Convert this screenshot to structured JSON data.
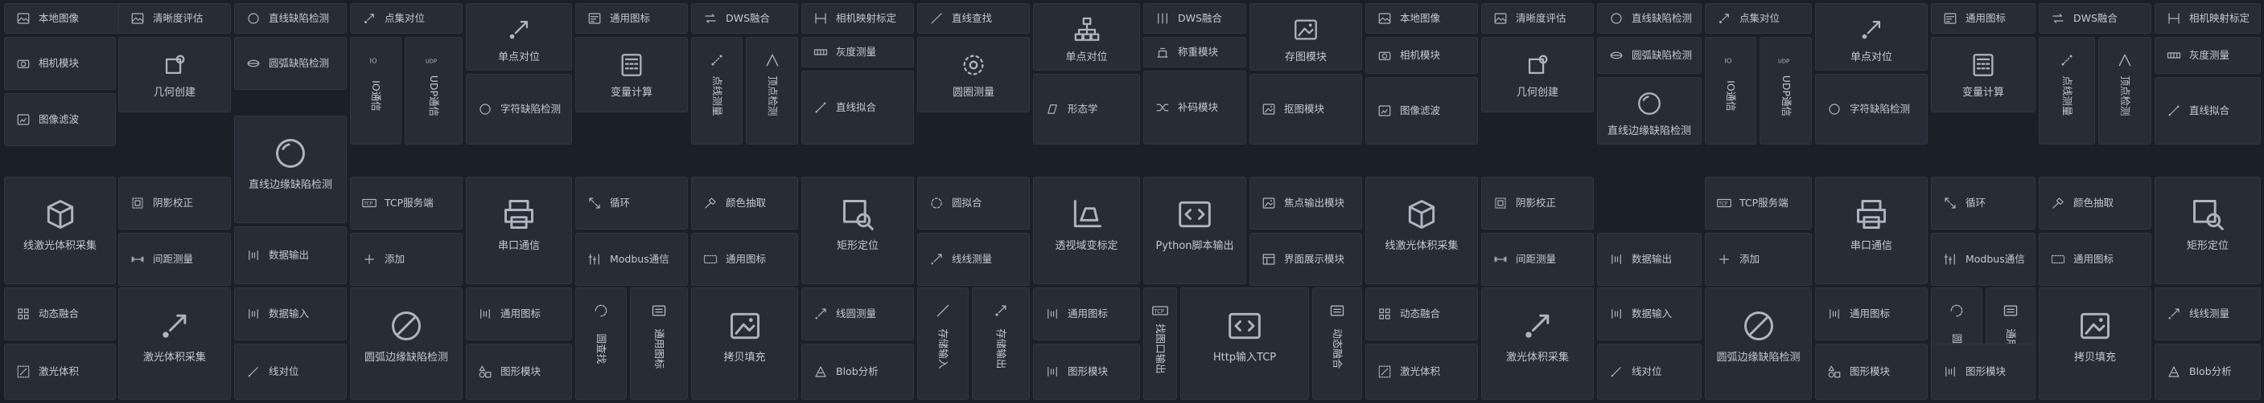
{
  "theme": {
    "background": "#1b2028",
    "tile": "#272d37",
    "text": "#c3c8d1",
    "icon": "#aeb5c1"
  },
  "tiles": [
    {
      "name": "local-image",
      "label": "本地图像",
      "icon": "image-icon",
      "style": "row"
    },
    {
      "name": "sharpness-eval",
      "label": "清晰度评估",
      "icon": "image-icon",
      "style": "row"
    },
    {
      "name": "line-defect-detect",
      "label": "直线缺陷检测",
      "icon": "circle-icon",
      "style": "row"
    },
    {
      "name": "point-align",
      "label": "点集对位",
      "icon": "point-arrow-icon",
      "style": "row"
    },
    {
      "name": "single-point-align",
      "label": "单点对位",
      "icon": "point-arrow-icon",
      "style": "col"
    },
    {
      "name": "general-chart",
      "label": "通用图标",
      "icon": "chart-icon",
      "style": "row"
    },
    {
      "name": "dws-fusion",
      "label": "DWS融合",
      "icon": "swap-icon",
      "style": "row"
    },
    {
      "name": "camera-map-calib",
      "label": "相机映射标定",
      "icon": "mapping-icon",
      "style": "row"
    },
    {
      "name": "line-find",
      "label": "直线查找",
      "icon": "line-icon",
      "style": "row"
    },
    {
      "name": "single-point-align-2",
      "label": "单点对位",
      "icon": "hierarchy-icon",
      "style": "col"
    },
    {
      "name": "dws-fusion-2",
      "label": "DWS融合",
      "icon": "dws-icon",
      "style": "row"
    },
    {
      "name": "store-image",
      "label": "存图模块",
      "icon": "picture-icon",
      "style": "col"
    },
    {
      "name": "local-image-2",
      "label": "本地图像",
      "icon": "image-icon",
      "style": "row"
    },
    {
      "name": "sharpness-eval-2",
      "label": "清晰度评估",
      "icon": "image-icon",
      "style": "row"
    },
    {
      "name": "line-defect-detect-2",
      "label": "直线缺陷检测",
      "icon": "circle-icon",
      "style": "row"
    },
    {
      "name": "point-align-2",
      "label": "点集对位",
      "icon": "point-arrow-icon",
      "style": "row"
    },
    {
      "name": "single-point-align-3",
      "label": "单点对位",
      "icon": "point-arrow-icon",
      "style": "col"
    },
    {
      "name": "general-chart-2",
      "label": "通用图标",
      "icon": "chart-icon",
      "style": "row"
    },
    {
      "name": "dws-fusion-3",
      "label": "DWS融合",
      "icon": "swap-icon",
      "style": "row"
    },
    {
      "name": "camera-map-calib-2",
      "label": "相机映射标定",
      "icon": "mapping-icon",
      "style": "row"
    },
    {
      "name": "camera-module",
      "label": "相机模块",
      "icon": "camera-icon",
      "style": "row"
    },
    {
      "name": "geometry-create",
      "label": "几何创建",
      "icon": "geometry-icon",
      "style": "col"
    },
    {
      "name": "circle-defect-detect",
      "label": "圆弧缺陷检测",
      "icon": "ellipse-icon",
      "style": "row"
    },
    {
      "name": "io-comm",
      "label": "IO通信",
      "icon": "io-icon",
      "style": "vert"
    },
    {
      "name": "udp-comm",
      "label": "UDP通信",
      "icon": "udp-icon",
      "style": "vert"
    },
    {
      "name": "variable-calc",
      "label": "变量计算",
      "icon": "calc-icon",
      "style": "col"
    },
    {
      "name": "dot-measure",
      "label": "点线测量",
      "icon": "dots-icon",
      "style": "vert"
    },
    {
      "name": "vertex-check",
      "label": "顶点检测",
      "icon": "vertex-icon",
      "style": "vert"
    },
    {
      "name": "gray-measure",
      "label": "灰度测量",
      "icon": "gray-icon",
      "style": "row"
    },
    {
      "name": "circle-measure",
      "label": "圆圈测量",
      "icon": "circles-icon",
      "style": "col"
    },
    {
      "name": "weigh-module",
      "label": "称重模块",
      "icon": "scale-icon",
      "style": "row"
    },
    {
      "name": "camera-module-2",
      "label": "相机模块",
      "icon": "camera-icon",
      "style": "row"
    },
    {
      "name": "geometry-create-2",
      "label": "几何创建",
      "icon": "geometry-icon",
      "style": "col"
    },
    {
      "name": "circle-defect-detect-2",
      "label": "圆弧缺陷检测",
      "icon": "ellipse-icon",
      "style": "row"
    },
    {
      "name": "io-comm-2",
      "label": "IO通信",
      "icon": "io-icon",
      "style": "vert"
    },
    {
      "name": "udp-comm-2",
      "label": "UDP通信",
      "icon": "udp-icon",
      "style": "vert"
    },
    {
      "name": "variable-calc-2",
      "label": "变量计算",
      "icon": "calc-icon",
      "style": "col"
    },
    {
      "name": "dot-measure-2",
      "label": "点线测量",
      "icon": "dots-icon",
      "style": "vert"
    },
    {
      "name": "vertex-check-2",
      "label": "顶点检测",
      "icon": "vertex-icon",
      "style": "vert"
    },
    {
      "name": "gray-measure-2",
      "label": "灰度测量",
      "icon": "gray-icon",
      "style": "row"
    },
    {
      "name": "image-filter",
      "label": "图像滤波",
      "icon": "filter-icon",
      "style": "row"
    },
    {
      "name": "line-edge-defect",
      "label": "直线边缘缺陷检测",
      "icon": "ring-icon",
      "style": "col"
    },
    {
      "name": "char-defect-detect",
      "label": "字符缺陷检测",
      "icon": "circle-icon",
      "style": "row"
    },
    {
      "name": "line-fit",
      "label": "直线拟合",
      "icon": "linefit-icon",
      "style": "row"
    },
    {
      "name": "morphology",
      "label": "形态学",
      "icon": "morph-icon",
      "style": "row"
    },
    {
      "name": "complement-module",
      "label": "补码模块",
      "icon": "shuffle-icon",
      "style": "row"
    },
    {
      "name": "save-image",
      "label": "抠图模块",
      "icon": "picture-icon",
      "style": "row"
    },
    {
      "name": "image-filter-2",
      "label": "图像滤波",
      "icon": "filter-icon",
      "style": "row"
    },
    {
      "name": "line-edge-defect-2",
      "label": "直线边缘缺陷检测",
      "icon": "ring-icon",
      "style": "col"
    },
    {
      "name": "char-defect-detect-2",
      "label": "字符缺陷检测",
      "icon": "circle-icon",
      "style": "row"
    },
    {
      "name": "line-fit-2",
      "label": "直线拟合",
      "icon": "linefit-icon",
      "style": "row"
    },
    {
      "name": "laser-volume-collect",
      "label": "线激光体积采集",
      "icon": "cube-icon",
      "style": "col"
    },
    {
      "name": "shadow-correct",
      "label": "阴影校正",
      "icon": "shadow-icon",
      "style": "row"
    },
    {
      "name": "tcp-server",
      "label": "TCP服务端",
      "icon": "tcp-icon",
      "style": "row"
    },
    {
      "name": "serial-comm",
      "label": "串口通信",
      "icon": "printer-icon",
      "style": "col"
    },
    {
      "name": "loop",
      "label": "循环",
      "icon": "expand-icon",
      "style": "row"
    },
    {
      "name": "color-extract",
      "label": "颜色抽取",
      "icon": "pipette-icon",
      "style": "row"
    },
    {
      "name": "rect-locate",
      "label": "矩形定位",
      "icon": "rect-search-icon",
      "style": "col"
    },
    {
      "name": "circle-fit",
      "label": "圆拟合",
      "icon": "circle-dash-icon",
      "style": "row"
    },
    {
      "name": "perspective-calib",
      "label": "透视域变标定",
      "icon": "perspective-icon",
      "style": "col"
    },
    {
      "name": "python-script",
      "label": "Python脚本输出",
      "icon": "code-icon",
      "style": "col"
    },
    {
      "name": "focus-output",
      "label": "焦点输出模块",
      "icon": "picture-icon",
      "style": "row"
    },
    {
      "name": "laser-volume-collect-2",
      "label": "线激光体积采集",
      "icon": "cube-icon",
      "style": "col"
    },
    {
      "name": "shadow-correct-2",
      "label": "阴影校正",
      "icon": "shadow-icon",
      "style": "row"
    },
    {
      "name": "tcp-server-2",
      "label": "TCP服务端",
      "icon": "tcp-icon",
      "style": "row"
    },
    {
      "name": "serial-comm-2",
      "label": "串口通信",
      "icon": "printer-icon",
      "style": "col"
    },
    {
      "name": "loop-2",
      "label": "循环",
      "icon": "expand-icon",
      "style": "row"
    },
    {
      "name": "color-extract-2",
      "label": "颜色抽取",
      "icon": "pipette-icon",
      "style": "row"
    },
    {
      "name": "rect-locate-2",
      "label": "矩形定位",
      "icon": "rect-search-icon",
      "style": "col"
    },
    {
      "name": "spacing-measure",
      "label": "间距测量",
      "icon": "spacing-icon",
      "style": "row"
    },
    {
      "name": "data-output",
      "label": "数据输出",
      "icon": "bracket-icon",
      "style": "row"
    },
    {
      "name": "add",
      "label": "添加",
      "icon": "plus-icon",
      "style": "row"
    },
    {
      "name": "modbus-comm",
      "label": "Modbus通信",
      "icon": "modbus-icon",
      "style": "row"
    },
    {
      "name": "general-chart-3",
      "label": "通用图标",
      "icon": "dots-box-icon",
      "style": "row"
    },
    {
      "name": "line-measure",
      "label": "线线测量",
      "icon": "arrow-line-icon",
      "style": "row"
    },
    {
      "name": "ui-display",
      "label": "界面展示模块",
      "icon": "layout-icon",
      "style": "row"
    },
    {
      "name": "spacing-measure-2",
      "label": "间距测量",
      "icon": "spacing-icon",
      "style": "row"
    },
    {
      "name": "data-output-2",
      "label": "数据输出",
      "icon": "bracket-icon",
      "style": "row"
    },
    {
      "name": "add-2",
      "label": "添加",
      "icon": "plus-icon",
      "style": "row"
    },
    {
      "name": "modbus-comm-2",
      "label": "Modbus通信",
      "icon": "modbus-icon",
      "style": "row"
    },
    {
      "name": "general-chart-4",
      "label": "通用图标",
      "icon": "dots-box-icon",
      "style": "row"
    },
    {
      "name": "dynamic-fusion",
      "label": "动态融合",
      "icon": "grid-icon",
      "style": "row"
    },
    {
      "name": "laser-volume-collect-3",
      "label": "激光体积采集",
      "icon": "point-arrow-icon",
      "style": "col"
    },
    {
      "name": "data-input",
      "label": "数据输入",
      "icon": "bracket-icon",
      "style": "row"
    },
    {
      "name": "arc-edge-defect",
      "label": "圆弧边缘缺陷检测",
      "icon": "no-entry-icon",
      "style": "col"
    },
    {
      "name": "general-chart-5",
      "label": "通用图标",
      "icon": "bracket-icon",
      "style": "row"
    },
    {
      "name": "circle-find",
      "label": "圆查找",
      "icon": "arc-icon",
      "style": "vert"
    },
    {
      "name": "general-chart-6",
      "label": "通用图标",
      "icon": "list-icon",
      "style": "vert"
    },
    {
      "name": "copy-fill",
      "label": "拷贝填充",
      "icon": "picture-icon",
      "style": "col"
    },
    {
      "name": "line-measure-2",
      "label": "线圆测量",
      "icon": "arrow-line-icon",
      "style": "row"
    },
    {
      "name": "store-input",
      "label": "存储输入",
      "icon": "line-icon",
      "style": "vert"
    },
    {
      "name": "store-output",
      "label": "存储输出",
      "icon": "point-arrow-icon",
      "style": "vert"
    },
    {
      "name": "general-chart-7",
      "label": "通用图标",
      "icon": "bracket-icon",
      "style": "row"
    },
    {
      "name": "tcp-input",
      "label": "找图口输出",
      "icon": "tcp-icon",
      "style": "vert"
    },
    {
      "name": "http-tcp-input",
      "label": "Http输入TCP",
      "icon": "code-icon",
      "style": "col"
    },
    {
      "name": "dynamic-fusion-v",
      "label": "动态融合",
      "icon": "list-icon",
      "style": "vert"
    },
    {
      "name": "dynamic-fusion-2",
      "label": "动态融合",
      "icon": "grid-icon",
      "style": "row"
    },
    {
      "name": "laser-volume-collect-4",
      "label": "激光体积采集",
      "icon": "point-arrow-icon",
      "style": "col"
    },
    {
      "name": "data-input-2",
      "label": "数据输入",
      "icon": "bracket-icon",
      "style": "row"
    },
    {
      "name": "arc-edge-defect-2",
      "label": "圆弧边缘缺陷检测",
      "icon": "no-entry-icon",
      "style": "col"
    },
    {
      "name": "general-chart-8",
      "label": "通用图标",
      "icon": "bracket-icon",
      "style": "row"
    },
    {
      "name": "circle-find-2",
      "label": "圆查找",
      "icon": "arc-icon",
      "style": "vert"
    },
    {
      "name": "general-chart-9",
      "label": "通用图标",
      "icon": "list-icon",
      "style": "vert"
    },
    {
      "name": "copy-fill-2",
      "label": "拷贝填充",
      "icon": "picture-icon",
      "style": "col"
    },
    {
      "name": "line-measure-3",
      "label": "线线测量",
      "icon": "arrow-line-icon",
      "style": "row"
    },
    {
      "name": "laser-volume",
      "label": "激光体积",
      "icon": "laser-icon",
      "style": "row"
    },
    {
      "name": "line-align",
      "label": "线对位",
      "icon": "diag-icon",
      "style": "row"
    },
    {
      "name": "shape-module",
      "label": "图形模块",
      "icon": "shapes-icon",
      "style": "row"
    },
    {
      "name": "blob-analysis",
      "label": "Blob分析",
      "icon": "blob-icon",
      "style": "row"
    },
    {
      "name": "graph-module",
      "label": "图形模块",
      "icon": "bracket-icon",
      "style": "row"
    },
    {
      "name": "laser-volume-2",
      "label": "激光体积",
      "icon": "laser-icon",
      "style": "row"
    },
    {
      "name": "line-align-2",
      "label": "线对位",
      "icon": "diag-icon",
      "style": "row"
    },
    {
      "name": "shape-module-2",
      "label": "图形模块",
      "icon": "shapes-icon",
      "style": "row"
    },
    {
      "name": "graph-module-2",
      "label": "图形模块",
      "icon": "bracket-icon",
      "style": "row"
    },
    {
      "name": "blob-analysis-2",
      "label": "Blob分析",
      "icon": "blob-icon",
      "style": "row"
    }
  ]
}
